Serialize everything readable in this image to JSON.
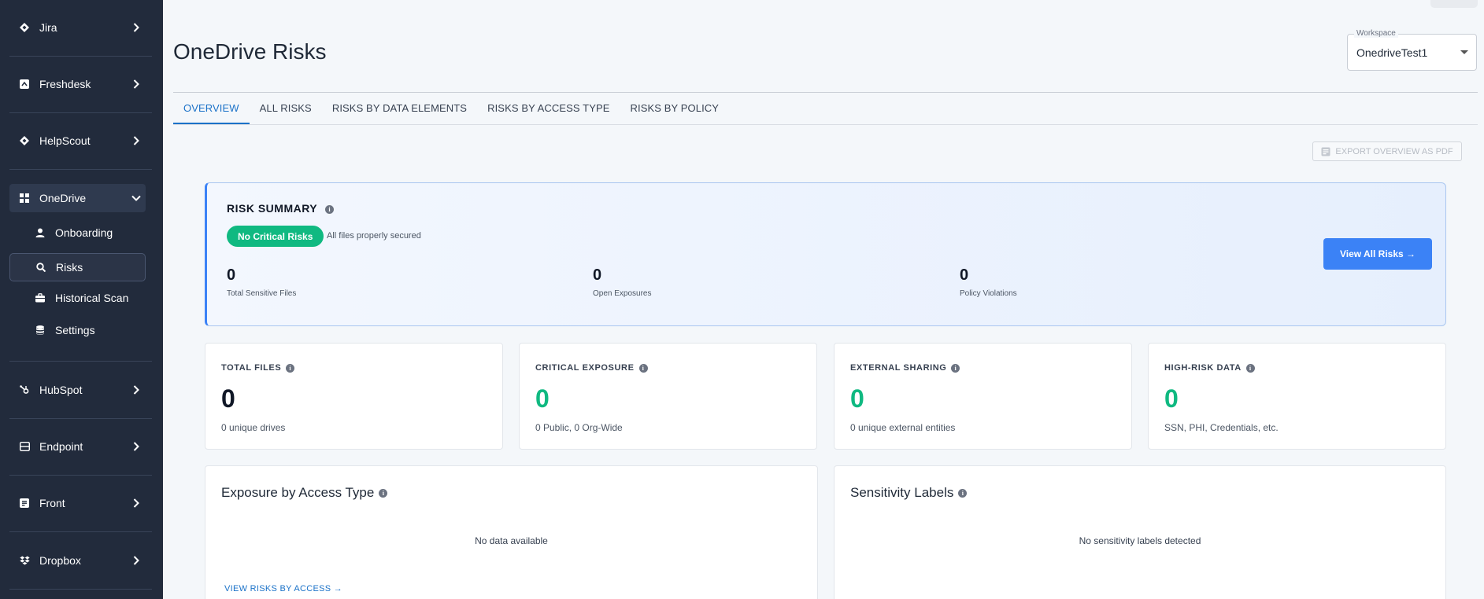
{
  "sidebar": {
    "groups": [
      {
        "label": "Jira",
        "icon": "diamond-icon"
      },
      {
        "label": "Freshdesk",
        "icon": "ticket-icon"
      },
      {
        "label": "HelpScout",
        "icon": "diamond-icon"
      },
      {
        "label": "OneDrive",
        "icon": "grid-icon"
      },
      {
        "label": "HubSpot",
        "icon": "hubspot-icon"
      },
      {
        "label": "Endpoint",
        "icon": "monitor-icon"
      },
      {
        "label": "Front",
        "icon": "front-icon"
      },
      {
        "label": "Dropbox",
        "icon": "dropbox-icon"
      }
    ],
    "onedrive_items": [
      {
        "label": "Onboarding",
        "icon": "user-icon"
      },
      {
        "label": "Risks",
        "icon": "search-icon"
      },
      {
        "label": "Historical Scan",
        "icon": "briefcase-icon"
      },
      {
        "label": "Settings",
        "icon": "database-icon"
      }
    ]
  },
  "header": {
    "title": "OneDrive Risks",
    "workspace_label": "Workspace",
    "workspace_value": "OnedriveTest1"
  },
  "tabs": [
    {
      "label": "OVERVIEW",
      "active": true
    },
    {
      "label": "ALL RISKS",
      "active": false
    },
    {
      "label": "RISKS BY DATA ELEMENTS",
      "active": false
    },
    {
      "label": "RISKS BY ACCESS TYPE",
      "active": false
    },
    {
      "label": "RISKS BY POLICY",
      "active": false
    }
  ],
  "export_label": "EXPORT OVERVIEW AS PDF",
  "risk_summary": {
    "title": "RISK SUMMARY",
    "badge": "No Critical Risks",
    "badge_note": "All files properly secured",
    "metrics": [
      {
        "value": "0",
        "label": "Total Sensitive Files"
      },
      {
        "value": "0",
        "label": "Open Exposures"
      },
      {
        "value": "0",
        "label": "Policy Violations"
      }
    ],
    "view_all_label": "View All Risks →"
  },
  "stats": [
    {
      "title": "TOTAL FILES",
      "value": "0",
      "sub": "0 unique drives",
      "color": "#111827"
    },
    {
      "title": "CRITICAL EXPOSURE",
      "value": "0",
      "sub": "0 Public, 0 Org-Wide",
      "color": "#10b981"
    },
    {
      "title": "EXTERNAL SHARING",
      "value": "0",
      "sub": "0 unique external entities",
      "color": "#10b981"
    },
    {
      "title": "HIGH-RISK DATA",
      "value": "0",
      "sub": "SSN, PHI, Credentials, etc.",
      "color": "#10b981"
    }
  ],
  "panels": {
    "exposure": {
      "title": "Exposure by Access Type",
      "empty": "No data available",
      "link": "VIEW RISKS BY ACCESS →"
    },
    "sensitivity": {
      "title": "Sensitivity Labels",
      "empty": "No sensitivity labels detected"
    }
  },
  "colors": {
    "sidebar_bg": "#222b3c",
    "accent": "#1b72c8",
    "success": "#10b981",
    "primary_button": "#3b82f6"
  }
}
